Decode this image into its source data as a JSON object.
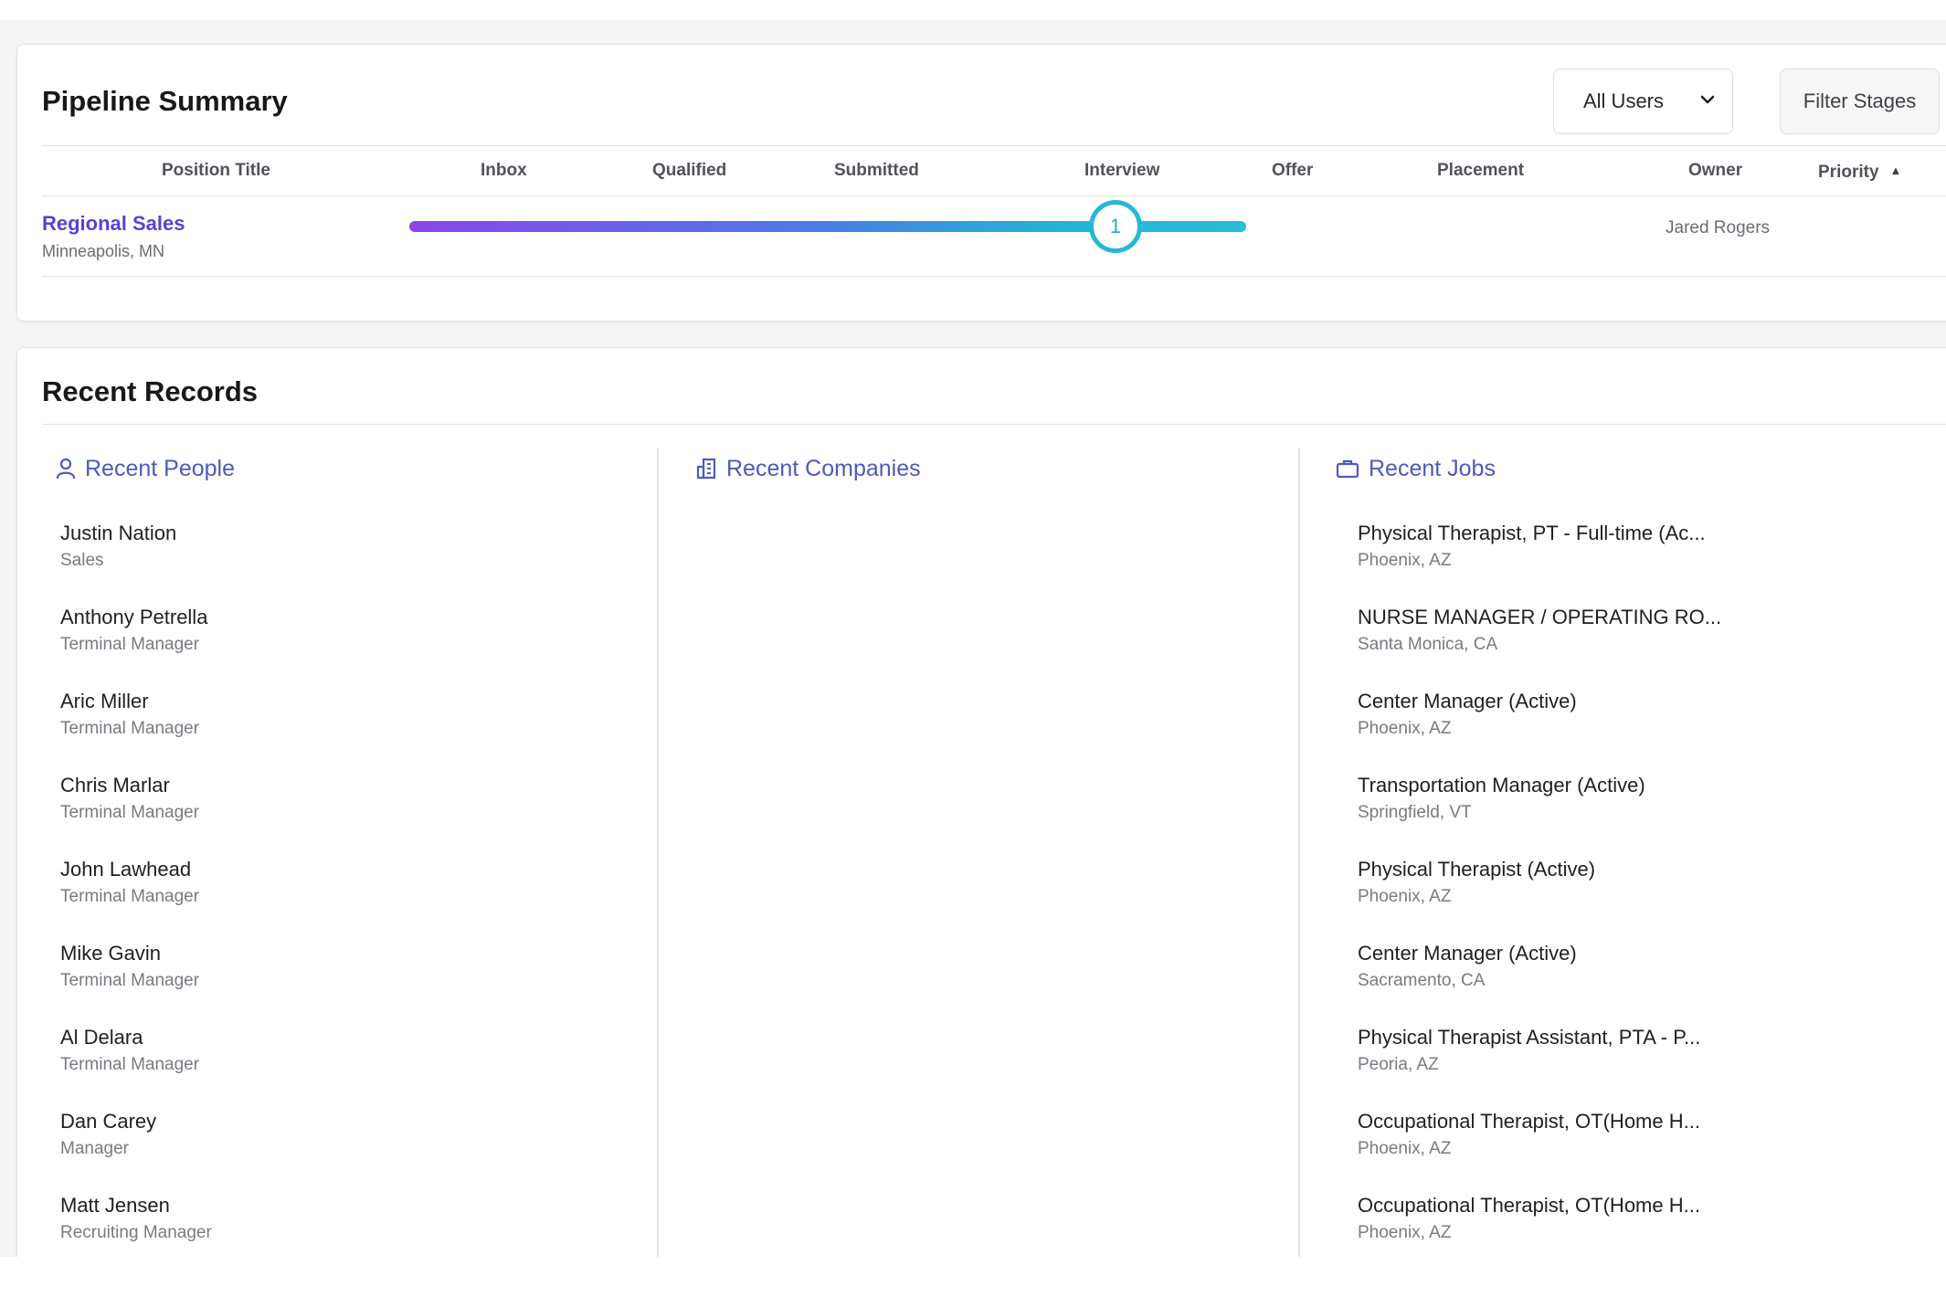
{
  "pipeline": {
    "title": "Pipeline Summary",
    "user_select": "All Users",
    "filter_label": "Filter Stages",
    "columns": [
      "Position Title",
      "Inbox",
      "Qualified",
      "Submitted",
      "Interview",
      "Offer",
      "Placement",
      "Owner",
      "Priority"
    ],
    "rows": [
      {
        "title": "Regional Sales",
        "location": "Minneapolis, MN",
        "stage": "Interview",
        "count": "1",
        "owner": "Jared Rogers"
      }
    ]
  },
  "recent": {
    "title": "Recent Records",
    "people": {
      "heading": "Recent People",
      "items": [
        {
          "name": "Justin Nation",
          "sub": "Sales"
        },
        {
          "name": "Anthony Petrella",
          "sub": "Terminal Manager"
        },
        {
          "name": "Aric Miller",
          "sub": "Terminal Manager"
        },
        {
          "name": "Chris Marlar",
          "sub": "Terminal Manager"
        },
        {
          "name": "John Lawhead",
          "sub": "Terminal Manager"
        },
        {
          "name": "Mike Gavin",
          "sub": "Terminal Manager"
        },
        {
          "name": "Al Delara",
          "sub": "Terminal Manager"
        },
        {
          "name": "Dan Carey",
          "sub": "Manager"
        },
        {
          "name": "Matt Jensen",
          "sub": "Recruiting Manager"
        }
      ]
    },
    "companies": {
      "heading": "Recent Companies",
      "items": []
    },
    "jobs": {
      "heading": "Recent Jobs",
      "items": [
        {
          "name": "Physical Therapist, PT - Full-time (Ac...",
          "sub": "Phoenix, AZ"
        },
        {
          "name": "NURSE MANAGER / OPERATING RO...",
          "sub": "Santa Monica, CA"
        },
        {
          "name": "Center Manager (Active)",
          "sub": "Phoenix, AZ"
        },
        {
          "name": "Transportation Manager (Active)",
          "sub": "Springfield, VT"
        },
        {
          "name": "Physical Therapist (Active)",
          "sub": "Phoenix, AZ"
        },
        {
          "name": "Center Manager (Active)",
          "sub": "Sacramento, CA"
        },
        {
          "name": "Physical Therapist Assistant, PTA - P...",
          "sub": "Peoria, AZ"
        },
        {
          "name": "Occupational Therapist, OT(Home H...",
          "sub": "Phoenix, AZ"
        },
        {
          "name": "Occupational Therapist, OT(Home H...",
          "sub": "Phoenix, AZ"
        }
      ]
    }
  },
  "icons": {
    "people": "person-icon",
    "companies": "building-icon",
    "jobs": "briefcase-icon",
    "select": "chevron-down-icon",
    "sort": "sort-asc-icon"
  },
  "colors": {
    "accent": "#4c5abf",
    "link": "#5b3fd6",
    "bar_start": "#8b46e8",
    "bar_end": "#28bcd8"
  }
}
